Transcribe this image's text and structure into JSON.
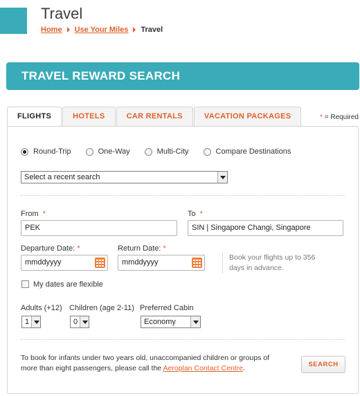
{
  "header": {
    "title": "Travel",
    "breadcrumb": {
      "home": "Home",
      "use_miles": "Use Your Miles",
      "current": "Travel"
    }
  },
  "banner": {
    "title": "TRAVEL REWARD SEARCH"
  },
  "tabs": [
    {
      "label": "FLIGHTS"
    },
    {
      "label": "HOTELS"
    },
    {
      "label": "CAR RENTALS"
    },
    {
      "label": "VACATION PACKAGES"
    }
  ],
  "required_note": {
    "star": "*",
    "text": " = Required"
  },
  "trip_types": [
    {
      "label": "Round-Trip",
      "checked": true
    },
    {
      "label": "One-Way",
      "checked": false
    },
    {
      "label": "Multi-City",
      "checked": false
    },
    {
      "label": "Compare Destinations",
      "checked": false
    }
  ],
  "recent_search": {
    "value": "Select a recent search"
  },
  "from": {
    "label": "From",
    "value": "PEK"
  },
  "to": {
    "label": "To",
    "value": "SIN | Singapore Changi, Singapore"
  },
  "required_marker": "*",
  "departure": {
    "label": "Departure Date:",
    "value": "mmddyyyy"
  },
  "return": {
    "label": "Return Date:",
    "value": "mmddyyyy"
  },
  "advance_note": "Book your flights up to 356 days in advance.",
  "flexible": {
    "label": "My dates are flexible",
    "checked": false
  },
  "adults": {
    "label": "Adults (+12)",
    "value": "1"
  },
  "children": {
    "label": "Children (age 2-11)",
    "value": "0"
  },
  "cabin": {
    "label": "Preferred Cabin",
    "value": "Economy"
  },
  "footer": {
    "text": "To book for infants under two years old, unaccompanied children or groups of more than eight passengers, please call the ",
    "link": "Aeroplan Contact Centre",
    "end": "."
  },
  "search_button": "SEARCH",
  "colors": {
    "teal": "#3aabb8",
    "accent_orange": "#e0602a"
  }
}
